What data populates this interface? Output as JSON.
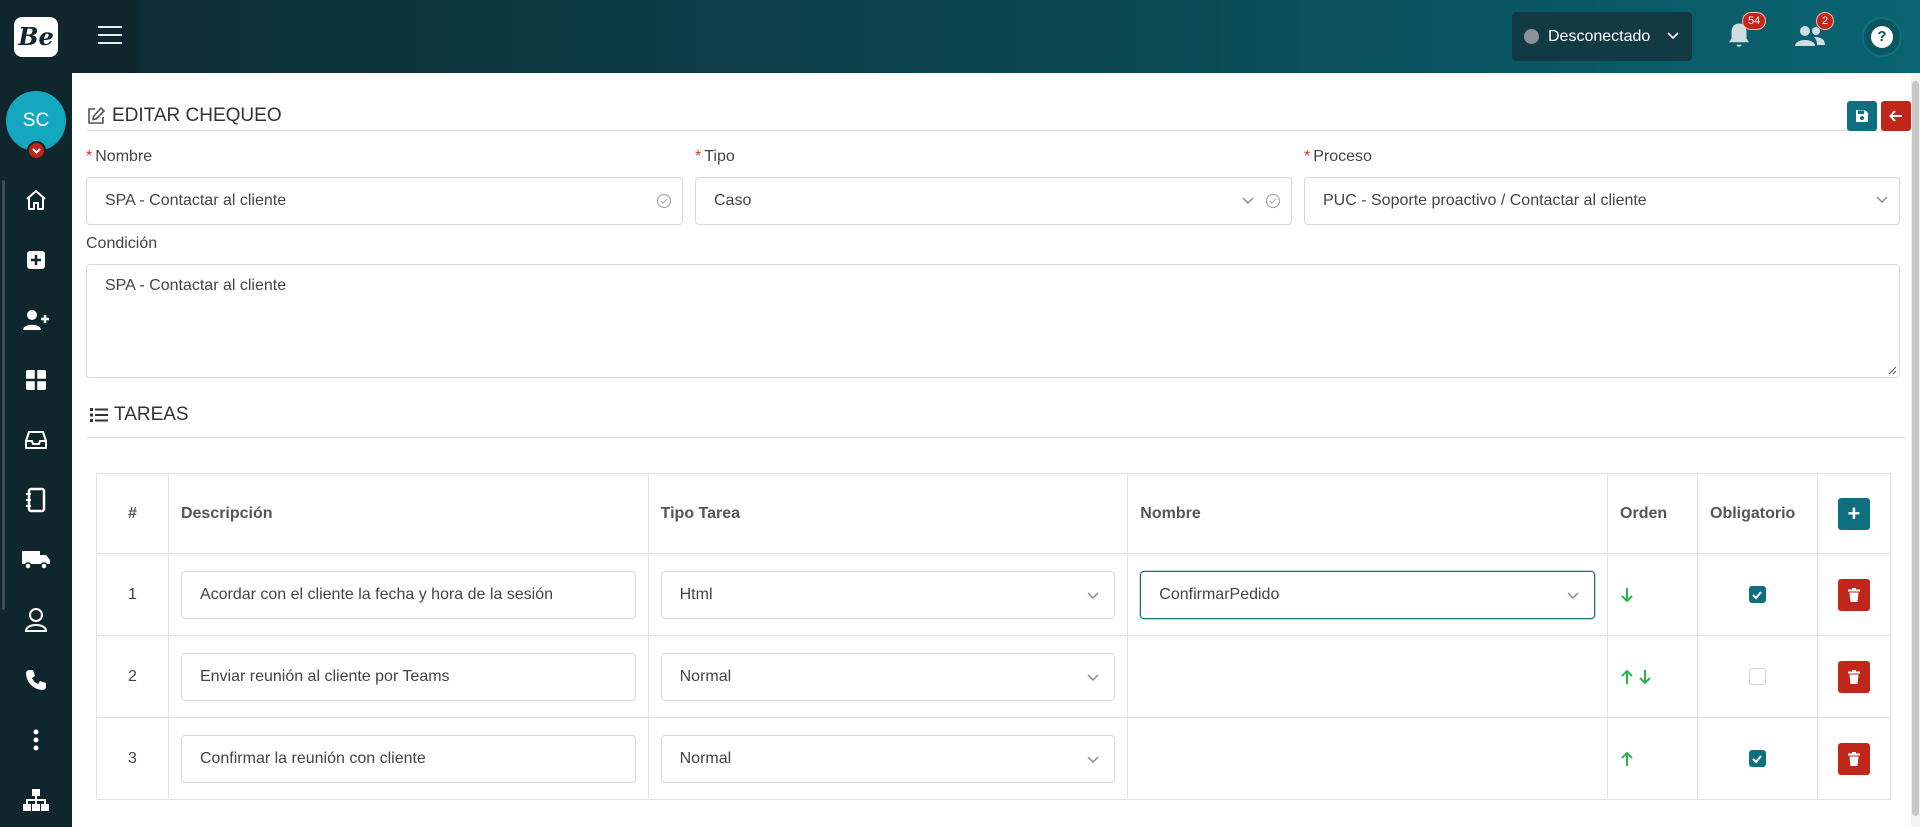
{
  "app": {
    "logo_text": "Be"
  },
  "topbar": {
    "status_label": "Desconectado",
    "notifications_count": "54",
    "users_count": "2",
    "help_label": "?"
  },
  "user": {
    "initials": "SC"
  },
  "page": {
    "title": "EDITAR CHEQUEO"
  },
  "form": {
    "nombre_label": "Nombre",
    "nombre_value": "SPA - Contactar al cliente",
    "tipo_label": "Tipo",
    "tipo_value": "Caso",
    "proceso_label": "Proceso",
    "proceso_value": "PUC - Soporte proactivo / Contactar al cliente",
    "condicion_label": "Condición",
    "condicion_value": "SPA - Contactar al cliente",
    "required_mark": "*"
  },
  "tasks": {
    "title": "TAREAS",
    "headers": {
      "num": "#",
      "descripcion": "Descripción",
      "tipo": "Tipo Tarea",
      "nombre": "Nombre",
      "orden": "Orden",
      "obligatorio": "Obligatorio",
      "add": "+"
    },
    "rows": [
      {
        "num": "1",
        "descripcion": "Acordar con el cliente la fecha y hora de la sesión",
        "tipo": "Html",
        "nombre": "ConfirmarPedido",
        "obligatorio": true
      },
      {
        "num": "2",
        "descripcion": "Enviar reunión al cliente por Teams",
        "tipo": "Normal",
        "nombre": "",
        "obligatorio": false
      },
      {
        "num": "3",
        "descripcion": "Confirmar la reunión con cliente",
        "tipo": "Normal",
        "nombre": "",
        "obligatorio": true
      }
    ]
  },
  "colors": {
    "accent": "#0e6f7e",
    "danger": "#c0271a",
    "arrow_green": "#2bb54a",
    "sidebar_bg": "#0f262c"
  }
}
